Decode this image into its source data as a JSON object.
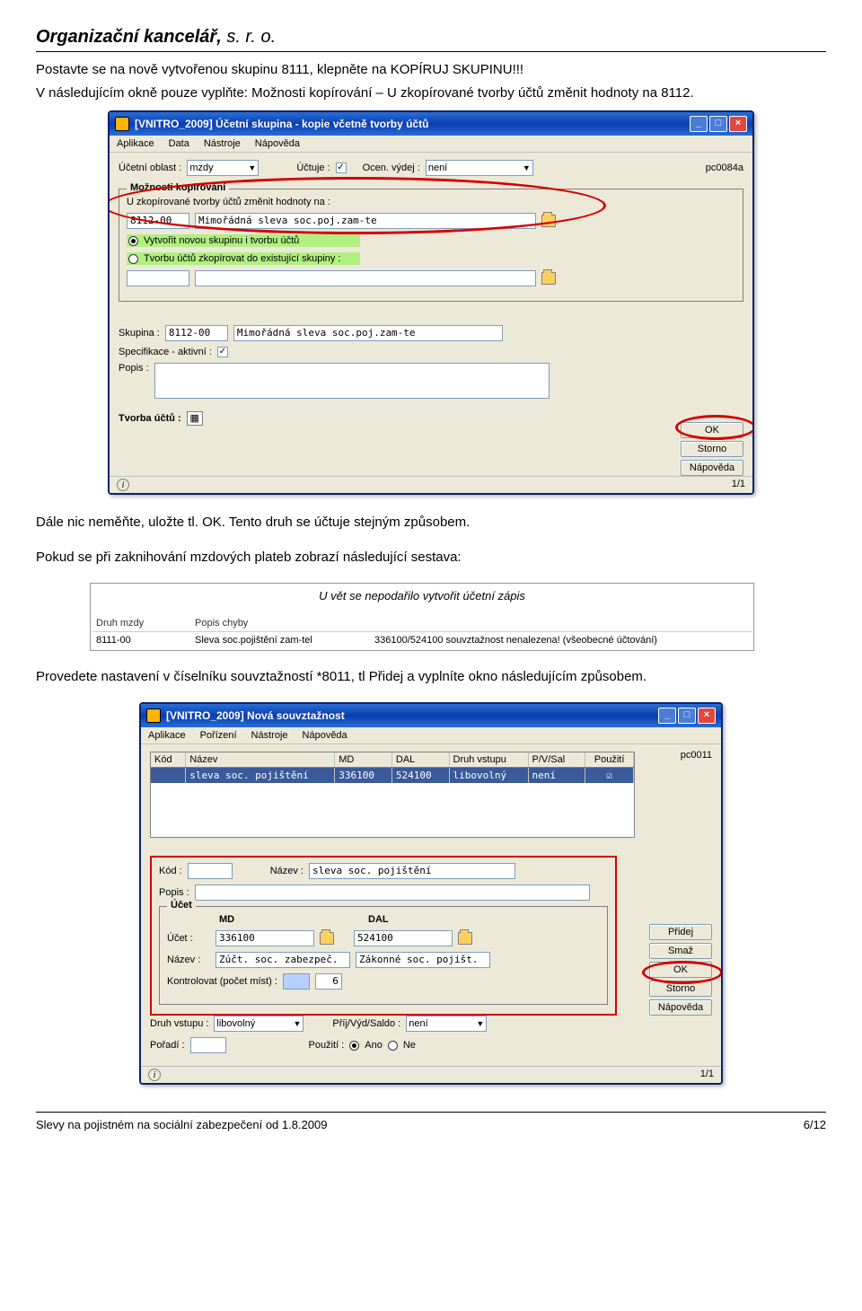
{
  "doc": {
    "company_bold": "Organizační kancelář,",
    "company_thin": " s. r. o.",
    "p1": "Postavte se na nově vytvořenou skupinu 8111, klepněte na KOPÍRUJ SKUPINU!!!",
    "p2": "V následujícím okně pouze vyplňte: Možnosti kopírování – U zkopírované tvorby účtů změnit hodnoty na 8112.",
    "p3": "Dále nic neměňte, uložte tl. OK. Tento druh se účtuje stejným způsobem.",
    "p4": "Pokud se při zaknihování mzdových plateb zobrazí následující sestava:",
    "p5": "Provedete nastavení v číselníku souvztažností *8011, tl Přidej a vyplníte okno následujícím způsobem.",
    "footer_left": "Slevy na pojistném na sociální zabezpečení od 1.8.2009",
    "footer_right": "6/12"
  },
  "win1": {
    "title": "[VNITRO_2009] Účetní skupina - kopie včetně tvorby účtů",
    "menu": [
      "Aplikace",
      "Data",
      "Nástroje",
      "Nápověda"
    ],
    "lbl_oblast": "Účetní oblast :",
    "oblast_val": "mzdy",
    "lbl_uctuje": "Účtuje :",
    "lbl_ocen": "Ocen. výdej :",
    "ocen_val": "není",
    "pc": "pc0084a",
    "grp_moznosti": "Možnosti kopírování",
    "moznosti_line": "U zkopírované tvorby účtů změnit hodnoty na :",
    "kod8112": "8112-00",
    "kod8112_name": "Mimořádná sleva soc.poj.zam-te",
    "radio1": "Vytvořit novou skupinu i tvorbu účtů",
    "radio2": "Tvorbu účtů zkopírovat do existující skupiny :",
    "lbl_skupina": "Skupina :",
    "skupina_kod": "8112-00",
    "skupina_name": "Mimořádná sleva soc.poj.zam-te",
    "lbl_spec": "Specifikace - aktivní :",
    "lbl_popis": "Popis :",
    "lbl_tvorba": "Tvorba účtů :",
    "btn_ok": "OK",
    "btn_storno": "Storno",
    "btn_nap": "Nápověda",
    "status": "1/1"
  },
  "err": {
    "title": "U vět se nepodařilo vytvořit účetní zápis",
    "h1": "Druh mzdy",
    "h2": "Popis chyby",
    "r_kod": "8111-00",
    "r_name": "Sleva soc.pojištění zam-tel",
    "r_msg": "336100/524100 souvztažnost nenalezena! (všeobecné účtování)"
  },
  "win2": {
    "title": "[VNITRO_2009] Nová souvztažnost",
    "menu": [
      "Aplikace",
      "Pořízení",
      "Nástroje",
      "Nápověda"
    ],
    "pc": "pc0011",
    "gh1": "Kód",
    "gh2": "Název",
    "gh3": "MD",
    "gh4": "DAL",
    "gh5": "Druh vstupu",
    "gh6": "P/V/Sal",
    "gh7": "Použití",
    "gr_kod": "",
    "gr_naz": "sleva soc. pojištění",
    "gr_md": "336100",
    "gr_dal": "524100",
    "gr_vstup": "libovolný",
    "gr_pvs": "není",
    "lbl_kod": "Kód :",
    "lbl_nazev": "Název :",
    "val_nazev": "sleva soc. pojištění",
    "lbl_popis": "Popis :",
    "grp_ucet": "Účet",
    "lbl_md": "MD",
    "lbl_dal": "DAL",
    "lbl_ucet": "Účet :",
    "val_md": "336100",
    "val_dal": "524100",
    "lbl_nazev2": "Název :",
    "val_mdname": "Zúčt. soc. zabezpeč.",
    "val_dalname": "Zákonné soc. pojišt.",
    "lbl_kontrol": "Kontrolovat (počet míst) :",
    "val_kontrol": "6",
    "lbl_druh": "Druh vstupu :",
    "val_druh": "libovolný",
    "lbl_pvs": "Příj/Výd/Saldo :",
    "val_pvs": "není",
    "lbl_poradi": "Pořadí :",
    "lbl_pouziti": "Použití :",
    "pouziti_ano": "Ano",
    "pouziti_ne": "Ne",
    "btn_pridej": "Přidej",
    "btn_smaz": "Smaž",
    "btn_ok": "OK",
    "btn_storno": "Storno",
    "btn_nap": "Nápověda",
    "status": "1/1"
  }
}
